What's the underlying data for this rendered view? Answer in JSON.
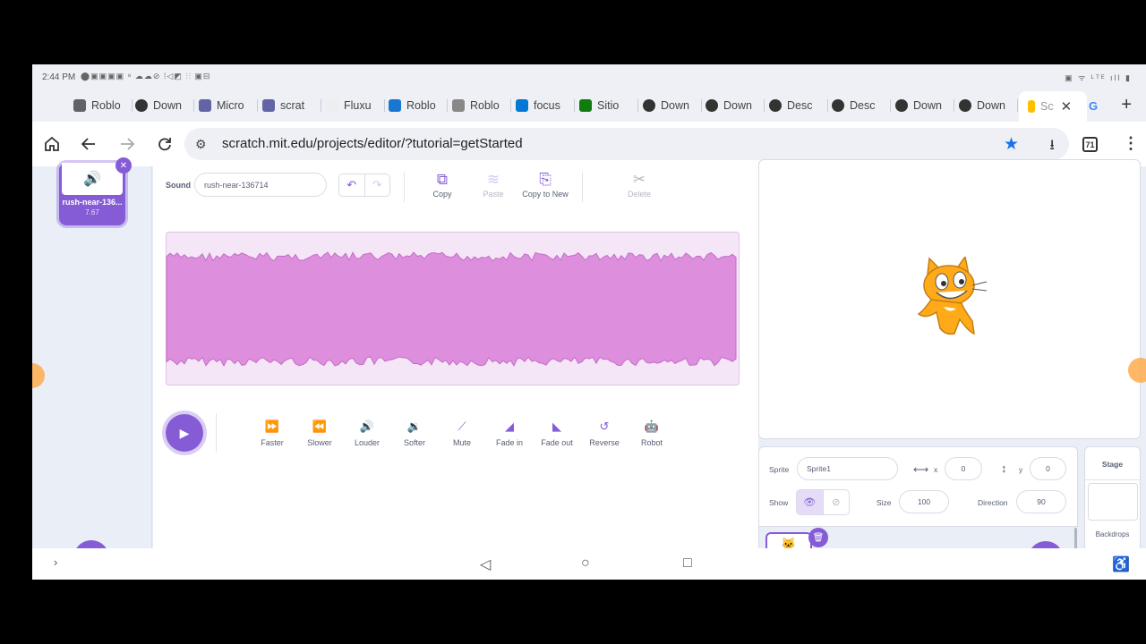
{
  "status_bar": {
    "time": "2:44 PM",
    "notif_icons": "⬤▣▣▣▣ ⁸ ☁☁⊘ ⁞◁◩ ⫶⫶ ▣⊟",
    "sys_icons": "▣ ᯤ ᴸᵀᴱ ıll ▮"
  },
  "tabs": [
    {
      "label": "Roblo",
      "icon": "doc-icon",
      "color": "#5f6368"
    },
    {
      "label": "Down",
      "icon": "chrome-icon",
      "color": "#333"
    },
    {
      "label": "Micro",
      "icon": "teams-icon",
      "color": "#6264a7"
    },
    {
      "label": "scrat",
      "icon": "teams-icon",
      "color": "#6264a7"
    },
    {
      "label": "Fluxu",
      "icon": "fluxus-icon",
      "color": "#eeeeee"
    },
    {
      "label": "Roblo",
      "icon": "roblox-icon",
      "color": "#1976d2"
    },
    {
      "label": "Roblo",
      "icon": "roblox-icon",
      "color": "#888"
    },
    {
      "label": "focus",
      "icon": "windows-icon",
      "color": "#0078d4"
    },
    {
      "label": "Sitio",
      "icon": "xbox-icon",
      "color": "#107c10"
    },
    {
      "label": "Down",
      "icon": "chrome-icon",
      "color": "#333"
    },
    {
      "label": "Down",
      "icon": "chrome-icon",
      "color": "#333"
    },
    {
      "label": "Desc",
      "icon": "chrome-icon",
      "color": "#333"
    },
    {
      "label": "Desc",
      "icon": "chrome-icon",
      "color": "#333"
    },
    {
      "label": "Down",
      "icon": "chrome-icon",
      "color": "#333"
    },
    {
      "label": "Down",
      "icon": "chrome-icon",
      "color": "#333"
    }
  ],
  "active_tab": {
    "label": "Sc",
    "close": "✕"
  },
  "google_tab": "G",
  "toolbar": {
    "url": "scratch.mit.edu/projects/editor/?tutorial=getStarted",
    "tab_count": "71"
  },
  "sound_list": {
    "name": "rush-near-136...",
    "duration": "7.67"
  },
  "sound_editor": {
    "label": "Sound",
    "name_value": "rush-near-136714",
    "buttons": {
      "copy": "Copy",
      "paste": "Paste",
      "copy_to_new": "Copy to New",
      "delete": "Delete"
    },
    "effects": [
      {
        "label": "Faster",
        "icon": "faster-icon",
        "glyph": "⏩"
      },
      {
        "label": "Slower",
        "icon": "slower-icon",
        "glyph": "⏪"
      },
      {
        "label": "Louder",
        "icon": "louder-icon",
        "glyph": "🔊"
      },
      {
        "label": "Softer",
        "icon": "softer-icon",
        "glyph": "🔉"
      },
      {
        "label": "Mute",
        "icon": "mute-icon",
        "glyph": "⟋"
      },
      {
        "label": "Fade in",
        "icon": "fade-in-icon",
        "glyph": "◢"
      },
      {
        "label": "Fade out",
        "icon": "fade-out-icon",
        "glyph": "◣"
      },
      {
        "label": "Reverse",
        "icon": "reverse-icon",
        "glyph": "↺"
      },
      {
        "label": "Robot",
        "icon": "robot-icon",
        "glyph": "🤖"
      }
    ],
    "waveform_fill": "#dd8fde",
    "waveform_bg": "#f5e6f7"
  },
  "sprite_info": {
    "sprite_label": "Sprite",
    "sprite_name": "Sprite1",
    "x_label": "x",
    "x_value": "0",
    "y_label": "y",
    "y_value": "0",
    "show_label": "Show",
    "size_label": "Size",
    "size_value": "100",
    "direction_label": "Direction",
    "direction_value": "90"
  },
  "stage_panel": {
    "title": "Stage",
    "backdrops": "Backdrops"
  },
  "colors": {
    "accent": "#855cd6",
    "sound_wave": "#dd8fde",
    "orange": "#ffab4c"
  }
}
